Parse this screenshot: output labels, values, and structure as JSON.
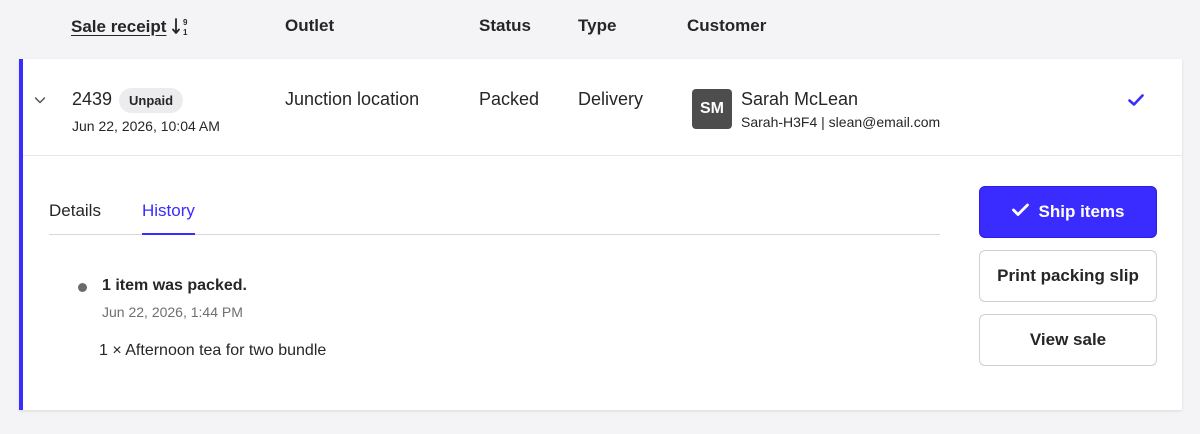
{
  "table_header": {
    "sale_receipt": "Sale receipt",
    "outlet": "Outlet",
    "status": "Status",
    "type": "Type",
    "customer": "Customer"
  },
  "row": {
    "receipt_number": "2439",
    "payment_badge": "Unpaid",
    "date": "Jun 22, 2026, 10:04 AM",
    "outlet": "Junction location",
    "status": "Packed",
    "type": "Delivery",
    "customer": {
      "initials": "SM",
      "name": "Sarah McLean",
      "details": "Sarah-H3F4 | slean@email.com"
    }
  },
  "tabs": [
    {
      "label": "Details",
      "active": false
    },
    {
      "label": "History",
      "active": true
    }
  ],
  "history": {
    "title": "1 item was packed.",
    "timestamp": "Jun 22, 2026, 1:44 PM",
    "item": "1 × Afternoon tea for two bundle"
  },
  "actions": {
    "ship_items": "Ship items",
    "print_packing_slip": "Print packing slip",
    "view_sale": "View sale"
  },
  "colors": {
    "accent": "#3a2bff",
    "avatar_bg": "#4d4d4d",
    "badge_bg": "#ececef"
  },
  "icons": {
    "sort": "sort-numeric-icon",
    "expand": "chevron-down-icon",
    "row_selected": "checkmark-icon",
    "ship": "checkmark-icon"
  }
}
